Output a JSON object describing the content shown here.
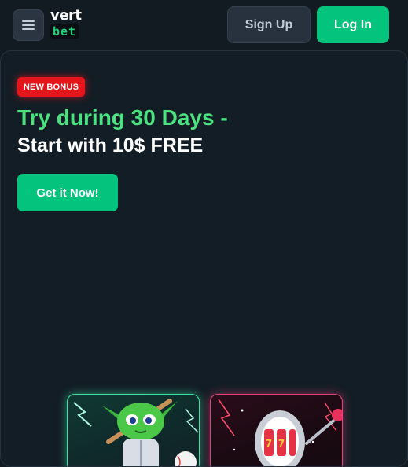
{
  "header": {
    "menu_icon": "hamburger-menu-icon",
    "logo": {
      "line1": "vert",
      "line2": "bet"
    },
    "signup_label": "Sign Up",
    "login_label": "Log In"
  },
  "hero": {
    "badge": "NEW BONUS",
    "headline_line1": "Try during 30 Days -",
    "headline_line2": "Start with 10$ FREE",
    "cta_label": "Get it Now!"
  },
  "games": [
    {
      "name": "alien-baseball-game-thumbnail",
      "icon": "green-alien-with-bat-icon"
    },
    {
      "name": "slot-machine-game-thumbnail",
      "icon": "slot-machine-icon"
    }
  ],
  "colors": {
    "background": "#121a22",
    "accent_green": "#04c37c",
    "headline_green": "#4be37f",
    "badge_red": "#e4161c",
    "secondary_button": "#27323e"
  }
}
